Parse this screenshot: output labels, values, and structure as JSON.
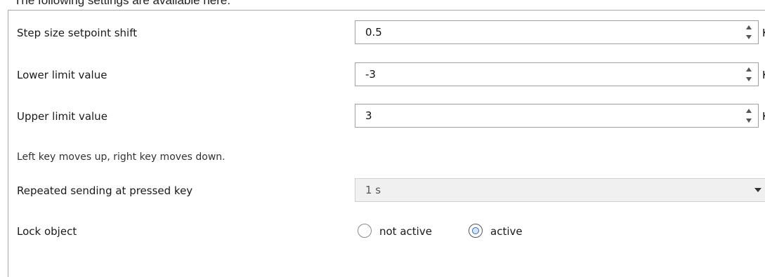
{
  "header": {
    "partial_text": "The following settings are available here:"
  },
  "fields": [
    {
      "label": "Step size setpoint shift",
      "value": "0.5",
      "unit": "K"
    },
    {
      "label": "Lower limit value",
      "value": "-3",
      "unit": "K"
    },
    {
      "label": "Upper limit value",
      "value": "3",
      "unit": "K"
    }
  ],
  "note": "Left key moves up, right key moves down.",
  "repeat": {
    "label": "Repeated sending at pressed key",
    "value": "1 s"
  },
  "lock": {
    "label": "Lock object",
    "options": [
      "not active",
      "active"
    ],
    "selected": "active"
  }
}
